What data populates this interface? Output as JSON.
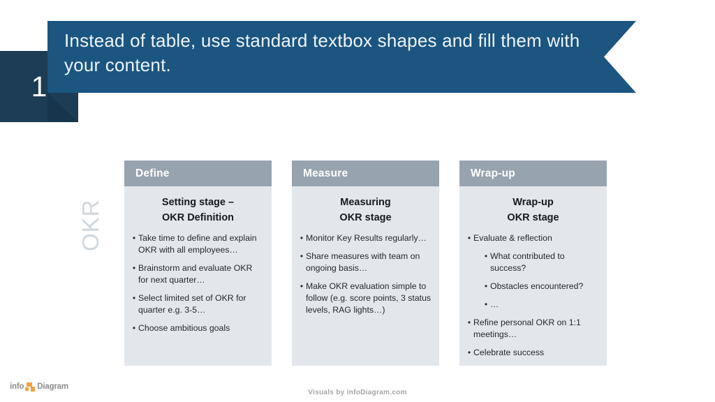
{
  "slide": {
    "step_number": "1",
    "banner_title": "Instead of table, use standard textbox shapes and fill them with your content.",
    "side_label": "OKR"
  },
  "colors": {
    "banner_blue": "#1b5580",
    "number_navy": "#1d3c55",
    "fold_navy": "#17354c",
    "card_header_gray": "#97a3af",
    "card_body_gray": "#e3e7ec",
    "side_label_gray": "#cfd6dd",
    "logo_orange": "#f0a040",
    "footer_gray": "#a6a6a6"
  },
  "cards": [
    {
      "header": "Define",
      "subtitle_line1": "Setting stage –",
      "subtitle_line2": "OKR Definition",
      "bullets": [
        {
          "level": 1,
          "text": "Take time to define and explain OKR with all employees…"
        },
        {
          "level": 1,
          "text": "Brainstorm and evaluate OKR for next quarter…"
        },
        {
          "level": 1,
          "text": "Select limited set of OKR for quarter e.g. 3-5…"
        },
        {
          "level": 1,
          "text": "Choose ambitious goals"
        }
      ]
    },
    {
      "header": "Measure",
      "subtitle_line1": "Measuring",
      "subtitle_line2": "OKR stage",
      "bullets": [
        {
          "level": 1,
          "text": "Monitor Key Results regularly…"
        },
        {
          "level": 1,
          "text": "Share measures with team on ongoing basis…"
        },
        {
          "level": 1,
          "text": "Make OKR evaluation simple to follow (e.g. score points, 3 status levels, RAG lights…)"
        }
      ]
    },
    {
      "header": "Wrap-up",
      "subtitle_line1": "Wrap-up",
      "subtitle_line2": "OKR stage",
      "bullets": [
        {
          "level": 1,
          "text": "Evaluate & reflection"
        },
        {
          "level": 2,
          "text": "What contributed to success?"
        },
        {
          "level": 2,
          "text": "Obstacles encountered?"
        },
        {
          "level": 2,
          "text": "…"
        },
        {
          "level": 1,
          "text": "Refine personal OKR on 1:1 meetings…"
        },
        {
          "level": 1,
          "text": "Celebrate success"
        }
      ]
    }
  ],
  "footer": {
    "credit": "Visuals by infoDiagram.com",
    "logo_info": "info",
    "logo_diagram": "Diagram"
  },
  "bullet_glyph": "•"
}
